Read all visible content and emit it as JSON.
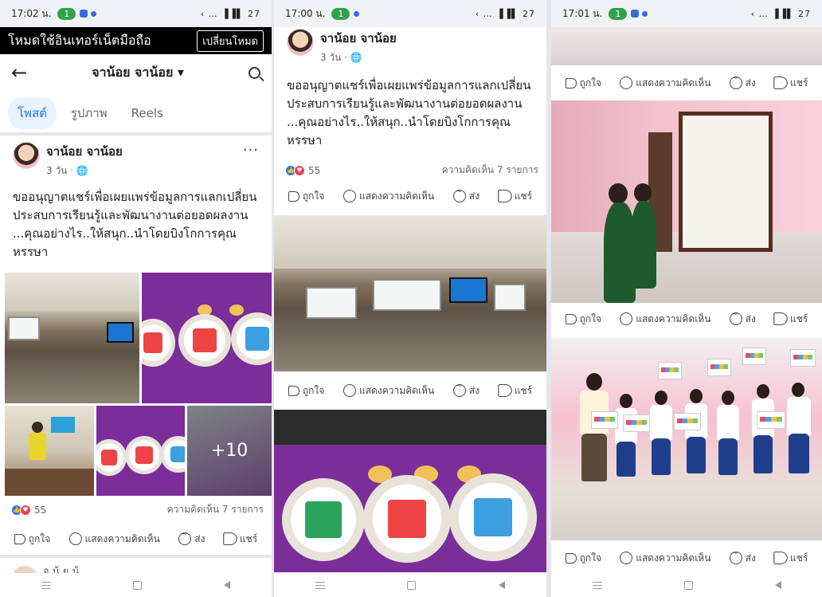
{
  "status": {
    "time_1": "17:02 น.",
    "time_2": "17:00 น.",
    "time_3": "17:01 น.",
    "pill": "1",
    "right": "‹ … ▐▐▌ 27"
  },
  "data_mode": {
    "text": "โหมดใช้อินเทอร์เน็ตมือถือ",
    "button": "เปลี่ยนโหมด"
  },
  "profile_nav": {
    "title": "จาน้อย จาน้อย ▾",
    "back": "←"
  },
  "tabs": [
    {
      "label": "โพสต์"
    },
    {
      "label": "รูปภาพ"
    },
    {
      "label": "Reels"
    }
  ],
  "post": {
    "author": "จาน้อย จาน้อย",
    "meta": "3 วัน · 🌐",
    "more": "···",
    "caption": "ขออนุญาตแชร์เพื่อเผยแพร่ข้อมูลการแลกเปลี่ยนประสบการเรียนรู้และพัฒนางานต่อยอดผลงาน ...คุณอย่างไร..ให้สนุก..นำโดยบิงโกการคุณหรรษา",
    "reaction_count": "55",
    "comments": "ความคิดเห็น 7 รายการ",
    "more_photos": "+10"
  },
  "actions": {
    "like": "ถูกใจ",
    "comment": "แสดงความคิดเห็น",
    "send": "ส่ง",
    "share": "แชร์"
  },
  "partial_next": {
    "name": "จ   น้   ย   น้"
  },
  "colors": {
    "facebook_blue": "#1877f2",
    "like_blue": "#1877f2",
    "love_red": "#f33e58",
    "tab_bg": "#e7f3ff",
    "status_green": "#31a24c"
  }
}
